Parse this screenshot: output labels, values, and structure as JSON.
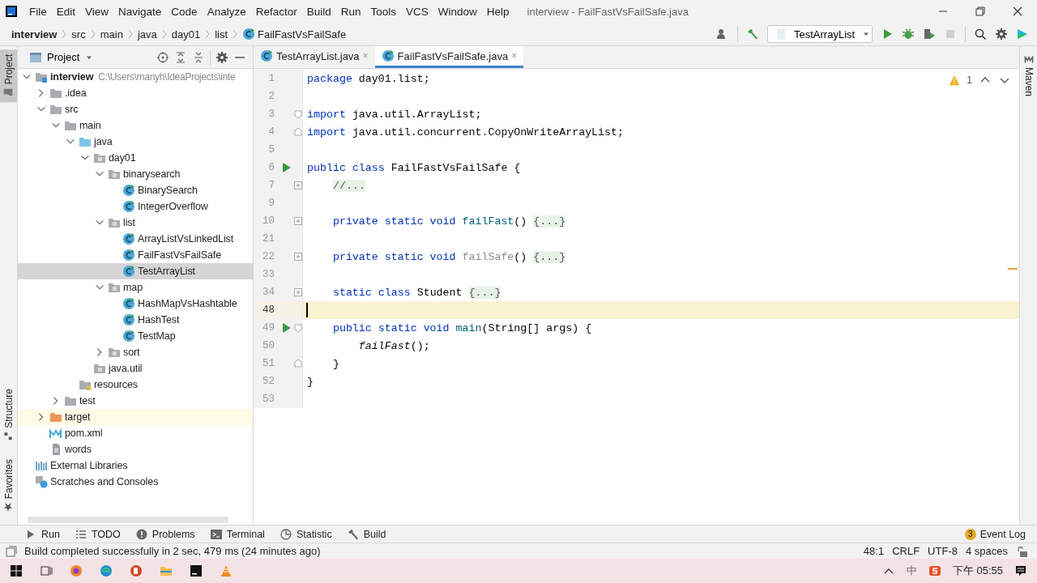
{
  "window": {
    "title": "interview - FailFastVsFailSafe.java",
    "menu": [
      "File",
      "Edit",
      "View",
      "Navigate",
      "Code",
      "Analyze",
      "Refactor",
      "Build",
      "Run",
      "Tools",
      "VCS",
      "Window",
      "Help"
    ]
  },
  "breadcrumbs": [
    "interview",
    "src",
    "main",
    "java",
    "day01",
    "list",
    "FailFastVsFailSafe"
  ],
  "toolbar": {
    "run_config": "TestArrayList"
  },
  "side_tabs": {
    "left_top": [
      {
        "label": "Project",
        "selected": true
      }
    ],
    "left_bottom": [
      {
        "label": "Structure",
        "selected": false
      },
      {
        "label": "Favorites",
        "selected": false
      }
    ],
    "right": [
      {
        "label": "Maven",
        "selected": false
      }
    ]
  },
  "project": {
    "title": "Project",
    "tree": [
      {
        "label": "interview",
        "kind": "module",
        "path": "C:\\Users\\manyh\\IdeaProjects\\inte",
        "expanded": true,
        "selected": false,
        "children": [
          {
            "label": ".idea",
            "kind": "folder",
            "expanded": false,
            "selected": false
          },
          {
            "label": "src",
            "kind": "folder",
            "expanded": true,
            "selected": false,
            "children": [
              {
                "label": "main",
                "kind": "folder",
                "expanded": true,
                "selected": false,
                "children": [
                  {
                    "label": "java",
                    "kind": "source-folder",
                    "expanded": true,
                    "selected": false,
                    "children": [
                      {
                        "label": "day01",
                        "kind": "package",
                        "expanded": true,
                        "selected": false,
                        "children": [
                          {
                            "label": "binarysearch",
                            "kind": "package",
                            "expanded": true,
                            "selected": false,
                            "children": [
                              {
                                "label": "BinarySearch",
                                "kind": "class",
                                "selected": false
                              },
                              {
                                "label": "IntegerOverflow",
                                "kind": "class",
                                "selected": false
                              }
                            ]
                          },
                          {
                            "label": "list",
                            "kind": "package",
                            "expanded": true,
                            "selected": false,
                            "children": [
                              {
                                "label": "ArrayListVsLinkedList",
                                "kind": "class",
                                "selected": false
                              },
                              {
                                "label": "FailFastVsFailSafe",
                                "kind": "class",
                                "selected": false
                              },
                              {
                                "label": "TestArrayList",
                                "kind": "class",
                                "selected": true
                              }
                            ]
                          },
                          {
                            "label": "map",
                            "kind": "package",
                            "expanded": true,
                            "selected": false,
                            "children": [
                              {
                                "label": "HashMapVsHashtable",
                                "kind": "class",
                                "selected": false
                              },
                              {
                                "label": "HashTest",
                                "kind": "class",
                                "selected": false
                              },
                              {
                                "label": "TestMap",
                                "kind": "class",
                                "selected": false
                              }
                            ]
                          },
                          {
                            "label": "sort",
                            "kind": "package",
                            "expanded": false,
                            "selected": false
                          }
                        ]
                      },
                      {
                        "label": "java.util",
                        "kind": "package",
                        "selected": false
                      }
                    ]
                  },
                  {
                    "label": "resources",
                    "kind": "resources-folder",
                    "selected": false
                  }
                ]
              },
              {
                "label": "test",
                "kind": "folder",
                "expanded": false,
                "selected": false
              }
            ]
          },
          {
            "label": "target",
            "kind": "excluded-folder",
            "expanded": false,
            "selected": false
          },
          {
            "label": "pom.xml",
            "kind": "maven",
            "selected": false
          },
          {
            "label": "words",
            "kind": "text",
            "selected": false
          }
        ]
      },
      {
        "label": "External Libraries",
        "kind": "library",
        "selected": false
      },
      {
        "label": "Scratches and Consoles",
        "kind": "scratches",
        "selected": false
      }
    ]
  },
  "editor": {
    "tabs": [
      {
        "label": "TestArrayList.java",
        "close": "×",
        "selected": false
      },
      {
        "label": "FailFastVsFailSafe.java",
        "close": "×",
        "selected": true
      }
    ],
    "warnings": "1",
    "lines": [
      {
        "number": "1",
        "kind": "plain",
        "current": false,
        "tokens": [
          {
            "text": "package",
            "kind": "keyword"
          },
          {
            "text": " day01.list;",
            "kind": "plain"
          }
        ]
      },
      {
        "number": "2",
        "kind": "plain",
        "current": false
      },
      {
        "number": "3",
        "kind": "fold-start",
        "current": false,
        "tokens": [
          {
            "text": "import",
            "kind": "keyword"
          },
          {
            "text": " java.util.ArrayList;",
            "kind": "plain"
          }
        ]
      },
      {
        "number": "4",
        "kind": "fold-end",
        "current": false,
        "tokens": [
          {
            "text": "import",
            "kind": "keyword"
          },
          {
            "text": " java.util.concurrent.CopyOnWriteArrayList;",
            "kind": "plain"
          }
        ]
      },
      {
        "number": "5",
        "kind": "plain",
        "current": false
      },
      {
        "number": "6",
        "kind": "plain",
        "current": false,
        "run": true,
        "tokens": [
          {
            "text": "public class",
            "kind": "keyword"
          },
          {
            "text": " FailFastVsFailSafe {",
            "kind": "plain"
          }
        ]
      },
      {
        "number": "7",
        "kind": "folded",
        "current": false,
        "tokens": [
          {
            "text": "    //...",
            "kind": "folded"
          }
        ]
      },
      {
        "number": "9",
        "kind": "plain",
        "current": false
      },
      {
        "number": "10",
        "kind": "folded",
        "current": false,
        "tokens": [
          {
            "text": "    private static void",
            "kind": "keyword"
          },
          {
            "text": " failFast",
            "kind": "method"
          },
          {
            "text": "() ",
            "kind": "plain"
          },
          {
            "text": "{...}",
            "kind": "folded"
          }
        ]
      },
      {
        "number": "21",
        "kind": "plain",
        "current": false
      },
      {
        "number": "22",
        "kind": "folded",
        "current": false,
        "tokens": [
          {
            "text": "    private static void",
            "kind": "keyword"
          },
          {
            "text": " failSafe",
            "kind": "unused"
          },
          {
            "text": "() ",
            "kind": "plain"
          },
          {
            "text": "{...}",
            "kind": "folded"
          }
        ]
      },
      {
        "number": "33",
        "kind": "plain",
        "current": false
      },
      {
        "number": "34",
        "kind": "folded",
        "current": false,
        "tokens": [
          {
            "text": "    static class",
            "kind": "keyword"
          },
          {
            "text": " Student ",
            "kind": "plain"
          },
          {
            "text": "{...}",
            "kind": "folded"
          }
        ]
      },
      {
        "number": "48",
        "kind": "plain",
        "current": true
      },
      {
        "number": "49",
        "kind": "fold-start",
        "current": false,
        "run": true,
        "tokens": [
          {
            "text": "    public static void",
            "kind": "keyword"
          },
          {
            "text": " main",
            "kind": "method"
          },
          {
            "text": "(String[] args) {",
            "kind": "plain"
          }
        ]
      },
      {
        "number": "50",
        "kind": "plain",
        "current": false,
        "tokens": [
          {
            "text": "        failFast",
            "kind": "static-call"
          },
          {
            "text": "();",
            "kind": "plain"
          }
        ]
      },
      {
        "number": "51",
        "kind": "fold-end",
        "current": false,
        "tokens": [
          {
            "text": "    }",
            "kind": "plain"
          }
        ]
      },
      {
        "number": "52",
        "kind": "plain",
        "current": false,
        "tokens": [
          {
            "text": "}",
            "kind": "plain"
          }
        ]
      },
      {
        "number": "53",
        "kind": "plain",
        "current": false
      }
    ]
  },
  "tool_tabs": [
    {
      "label": "Run",
      "kind": "run"
    },
    {
      "label": "TODO",
      "kind": "todo"
    },
    {
      "label": "Problems",
      "kind": "problems"
    },
    {
      "label": "Terminal",
      "kind": "terminal"
    },
    {
      "label": "Statistic",
      "kind": "statistic"
    },
    {
      "label": "Build",
      "kind": "build"
    }
  ],
  "event_log": {
    "label": "Event Log",
    "count": "3"
  },
  "status_bar": {
    "message": "Build completed successfully in 2 sec, 479 ms (24 minutes ago)",
    "items": [
      "48:1",
      "CRLF",
      "UTF-8",
      "4 spaces"
    ]
  },
  "taskbar": {
    "ime": "中",
    "clock": "下午 05:55"
  }
}
